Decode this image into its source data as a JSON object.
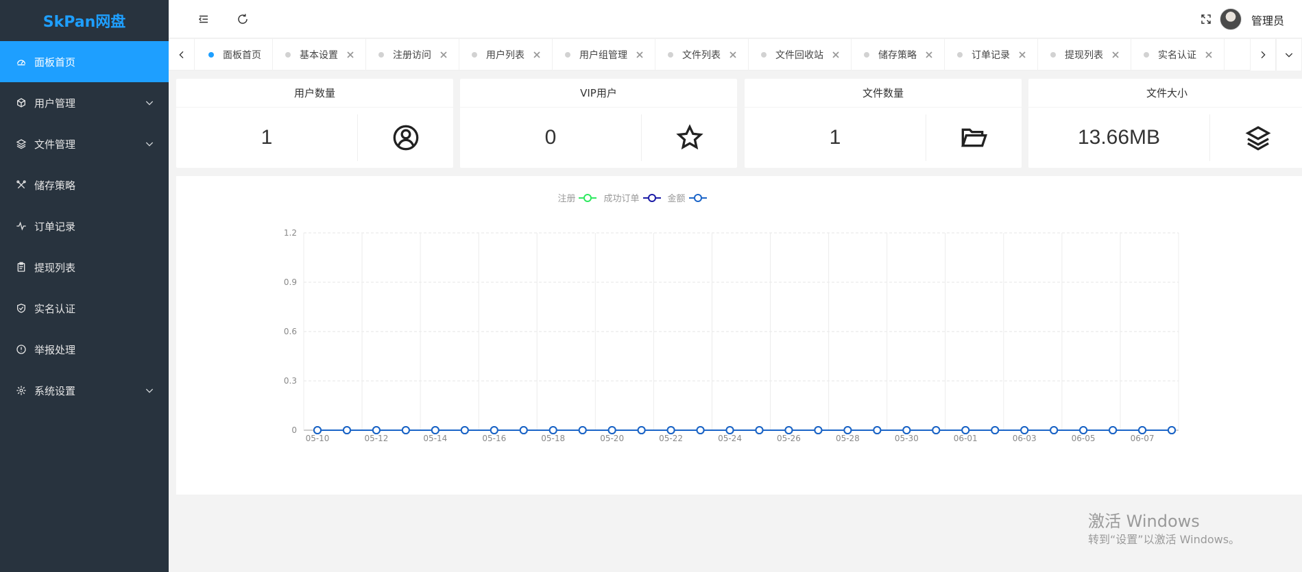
{
  "app": {
    "logo": "SkPan网盘",
    "accent": "#1e9fff",
    "sidebar_bg": "#28333e"
  },
  "sidebar": {
    "items": [
      {
        "label": "面板首页",
        "icon": "dashboard-icon",
        "active": true,
        "has_children": false
      },
      {
        "label": "用户管理",
        "icon": "cube-icon",
        "active": false,
        "has_children": true
      },
      {
        "label": "文件管理",
        "icon": "layers-icon",
        "active": false,
        "has_children": true
      },
      {
        "label": "储存策略",
        "icon": "tools-icon",
        "active": false,
        "has_children": false
      },
      {
        "label": "订单记录",
        "icon": "pulse-icon",
        "active": false,
        "has_children": false
      },
      {
        "label": "提现列表",
        "icon": "clipboard-icon",
        "active": false,
        "has_children": false
      },
      {
        "label": "实名认证",
        "icon": "shield-check-icon",
        "active": false,
        "has_children": false
      },
      {
        "label": "举报处理",
        "icon": "info-circle-icon",
        "active": false,
        "has_children": false
      },
      {
        "label": "系统设置",
        "icon": "gear-icon",
        "active": false,
        "has_children": true
      }
    ]
  },
  "header": {
    "user_name": "管理员",
    "icons": [
      "collapse-menu-icon",
      "refresh-icon",
      "fullscreen-icon"
    ]
  },
  "tabs": [
    {
      "label": "面板首页",
      "active": true,
      "closable": false
    },
    {
      "label": "基本设置",
      "active": false,
      "closable": true
    },
    {
      "label": "注册访问",
      "active": false,
      "closable": true
    },
    {
      "label": "用户列表",
      "active": false,
      "closable": true
    },
    {
      "label": "用户组管理",
      "active": false,
      "closable": true
    },
    {
      "label": "文件列表",
      "active": false,
      "closable": true
    },
    {
      "label": "文件回收站",
      "active": false,
      "closable": true
    },
    {
      "label": "储存策略",
      "active": false,
      "closable": true
    },
    {
      "label": "订单记录",
      "active": false,
      "closable": true
    },
    {
      "label": "提现列表",
      "active": false,
      "closable": true
    },
    {
      "label": "实名认证",
      "active": false,
      "closable": true
    }
  ],
  "cards": [
    {
      "title": "用户数量",
      "value": "1",
      "icon": "user-circle-icon"
    },
    {
      "title": "VIP用户",
      "value": "0",
      "icon": "star-icon"
    },
    {
      "title": "文件数量",
      "value": "1",
      "icon": "folder-open-icon"
    },
    {
      "title": "文件大小",
      "value": "13.66MB",
      "icon": "layers-icon"
    }
  ],
  "watermark": {
    "line1": "激活 Windows",
    "line2": "转到“设置”以激活 Windows。"
  },
  "chart_data": {
    "type": "line",
    "x": [
      "05-10",
      "05-11",
      "05-12",
      "05-13",
      "05-14",
      "05-15",
      "05-16",
      "05-17",
      "05-18",
      "05-19",
      "05-20",
      "05-21",
      "05-22",
      "05-23",
      "05-24",
      "05-25",
      "05-26",
      "05-27",
      "05-28",
      "05-29",
      "05-30",
      "05-31",
      "06-01",
      "06-02",
      "06-03",
      "06-04",
      "06-05",
      "06-06",
      "06-07",
      "06-08"
    ],
    "x_tick_labels": [
      "05-10",
      "05-12",
      "05-14",
      "05-16",
      "05-18",
      "05-20",
      "05-22",
      "05-24",
      "05-26",
      "05-28",
      "05-30",
      "06-01",
      "06-03",
      "06-05",
      "06-07"
    ],
    "series": [
      {
        "name": "注册",
        "color": "#2ee95f",
        "values": [
          0,
          0,
          0,
          0,
          0,
          0,
          0,
          0,
          0,
          0,
          0,
          0,
          0,
          0,
          0,
          0,
          0,
          0,
          0,
          0,
          0,
          0,
          0,
          0,
          0,
          0,
          0,
          0,
          0,
          0
        ]
      },
      {
        "name": "成功订单",
        "color": "#1a1aa6",
        "values": [
          0,
          0,
          0,
          0,
          0,
          0,
          0,
          0,
          0,
          0,
          0,
          0,
          0,
          0,
          0,
          0,
          0,
          0,
          0,
          0,
          0,
          0,
          0,
          0,
          0,
          0,
          0,
          0,
          0,
          0
        ]
      },
      {
        "name": "金额",
        "color": "#1a64c8",
        "values": [
          0,
          0,
          0,
          0,
          0,
          0,
          0,
          0,
          0,
          0,
          0,
          0,
          0,
          0,
          0,
          0,
          0,
          0,
          0,
          0,
          0,
          0,
          0,
          0,
          0,
          0,
          0,
          0,
          0,
          0
        ]
      }
    ],
    "y_ticks": [
      "0",
      "0.3",
      "0.6",
      "0.9",
      "1.2"
    ],
    "ylim": [
      0,
      1.2
    ],
    "grid": true,
    "legend_position": "top-center"
  }
}
